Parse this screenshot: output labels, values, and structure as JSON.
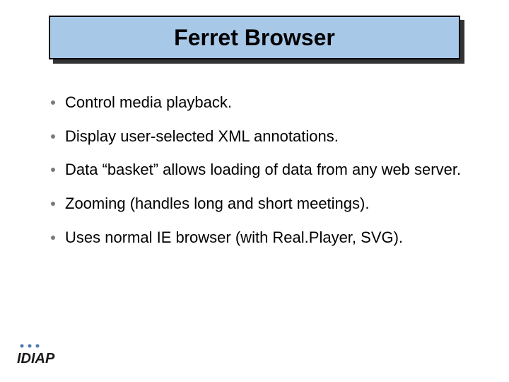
{
  "title": "Ferret Browser",
  "bullets": [
    "Control media playback.",
    "Display user-selected XML annotations.",
    "Data “basket” allows loading of data from any web server.",
    "Zooming (handles long and short meetings).",
    "Uses normal IE browser (with Real.Player, SVG)."
  ]
}
